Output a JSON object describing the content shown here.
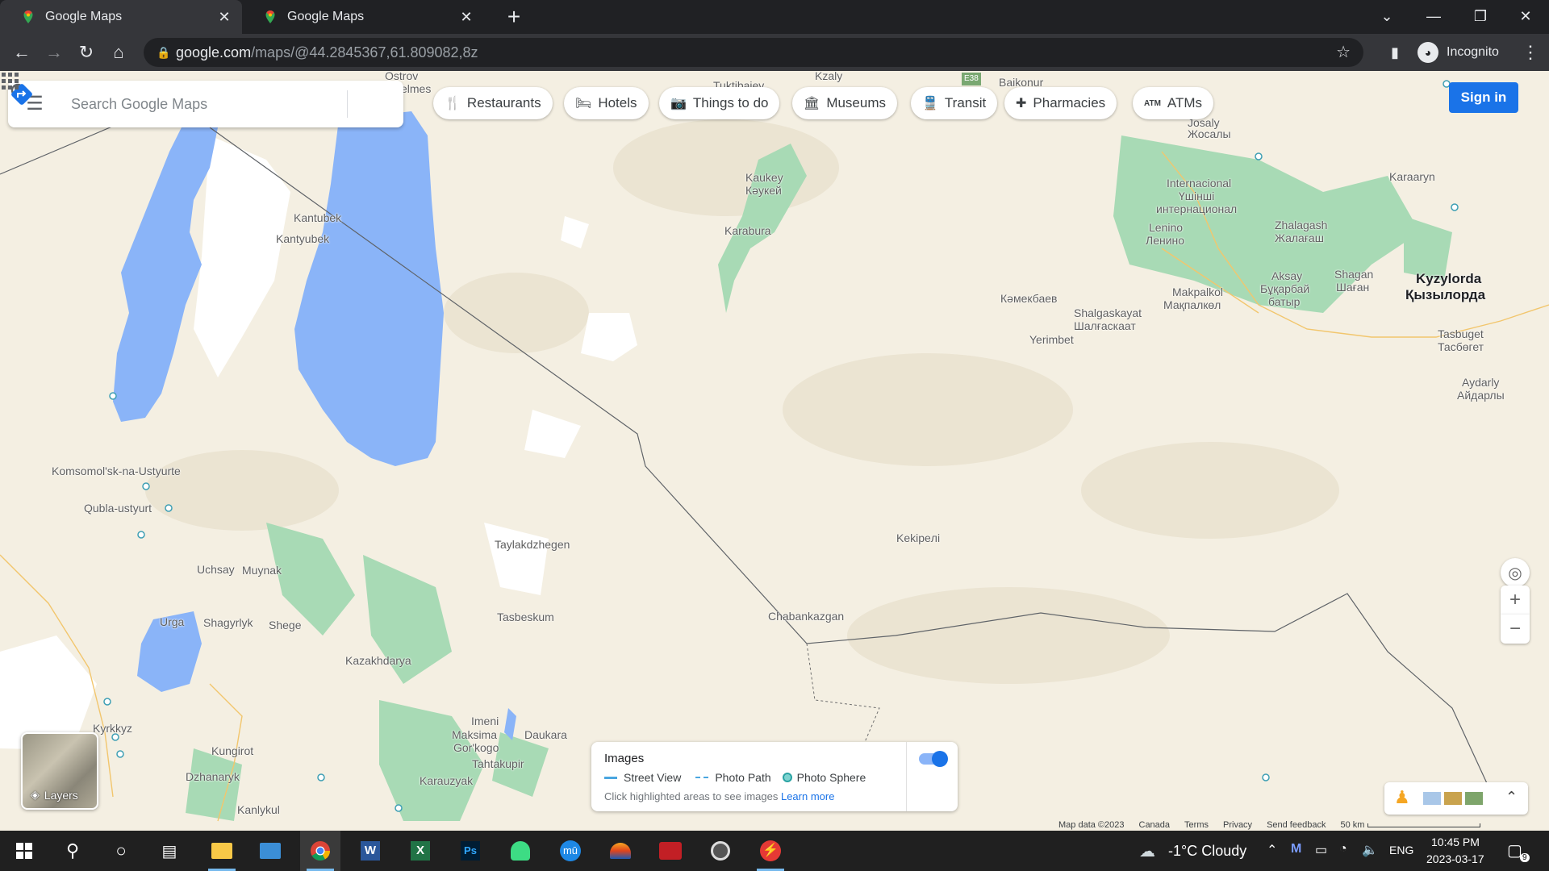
{
  "browser": {
    "tabs": [
      {
        "title": "Google Maps",
        "active": true
      },
      {
        "title": "Google Maps",
        "active": false
      }
    ],
    "url_host": "google.com",
    "url_path": "/maps/@44.2845367,61.809082,8z",
    "incognito_label": "Incognito"
  },
  "maps": {
    "search_placeholder": "Search Google Maps",
    "chips": [
      {
        "label": "Restaurants",
        "icon": "fork-knife-icon"
      },
      {
        "label": "Hotels",
        "icon": "bed-icon"
      },
      {
        "label": "Things to do",
        "icon": "camera-icon"
      },
      {
        "label": "Museums",
        "icon": "museum-icon"
      },
      {
        "label": "Transit",
        "icon": "train-icon"
      },
      {
        "label": "Pharmacies",
        "icon": "pharmacy-icon"
      },
      {
        "label": "ATMs",
        "icon": "atm-icon"
      }
    ],
    "sign_in": "Sign in",
    "layers_label": "Layers",
    "images_panel": {
      "title": "Images",
      "street_view": "Street View",
      "photo_path": "Photo Path",
      "photo_sphere": "Photo Sphere",
      "hint": "Click highlighted areas to see images",
      "learn_more": "Learn more",
      "toggle_on": true
    },
    "footer": {
      "map_data": "Map data ©2023",
      "country": "Canada",
      "terms": "Terms",
      "privacy": "Privacy",
      "feedback": "Send feedback",
      "scale": "50 km"
    },
    "places": [
      {
        "name": "Ostrov",
        "id": "p1"
      },
      {
        "name": "elmes",
        "id": "p2"
      },
      {
        "name": "Tuktibaiev",
        "id": "p3"
      },
      {
        "name": "Kzaly",
        "id": "p4"
      },
      {
        "name": "Baikonur",
        "id": "p5"
      },
      {
        "name": "E38",
        "id": "p6"
      },
      {
        "name": "Kaukey",
        "id": "p7"
      },
      {
        "name": "Кәукей",
        "id": "p8"
      },
      {
        "name": "Karabura",
        "id": "p9"
      },
      {
        "name": "Kantubek",
        "id": "p10"
      },
      {
        "name": "Kantyubek",
        "id": "p11"
      },
      {
        "name": "Komsomol'sk-na-Ustyurte",
        "id": "p12"
      },
      {
        "name": "Qubla-ustyurt",
        "id": "p13"
      },
      {
        "name": "Taylakdzhegen",
        "id": "p14"
      },
      {
        "name": "Uchsay",
        "id": "p15"
      },
      {
        "name": "Muynak",
        "id": "p16"
      },
      {
        "name": "Urga",
        "id": "p17"
      },
      {
        "name": "Shagyrlyk",
        "id": "p18"
      },
      {
        "name": "Shege",
        "id": "p19"
      },
      {
        "name": "Tasbeskum",
        "id": "p20"
      },
      {
        "name": "Kazakhdarya",
        "id": "p21"
      },
      {
        "name": "Chabankazgan",
        "id": "p22"
      },
      {
        "name": "Kekipeлi",
        "id": "p23"
      },
      {
        "name": "Kyrkkyz",
        "id": "p24"
      },
      {
        "name": "Kungirot",
        "id": "p25"
      },
      {
        "name": "Dzhanaryk",
        "id": "p26"
      },
      {
        "name": "Kanlykul",
        "id": "p27"
      },
      {
        "name": "Imeni",
        "id": "p28"
      },
      {
        "name": "Maksima",
        "id": "p29"
      },
      {
        "name": "Gor'kogo",
        "id": "p30"
      },
      {
        "name": "Daukara",
        "id": "p31"
      },
      {
        "name": "Tahtakupir",
        "id": "p32"
      },
      {
        "name": "Karauzyak",
        "id": "p33"
      },
      {
        "name": "Кәмекбаев",
        "id": "p34"
      },
      {
        "name": "Shalgaskayat",
        "id": "p35"
      },
      {
        "name": "Шалғаскаат",
        "id": "p36"
      },
      {
        "name": "Yerimbet",
        "id": "p37"
      },
      {
        "name": "Internacional",
        "id": "p38"
      },
      {
        "name": "Үшінші",
        "id": "p39"
      },
      {
        "name": "интернационал",
        "id": "p40"
      },
      {
        "name": "Lenino",
        "id": "p41"
      },
      {
        "name": "Ленино",
        "id": "p42"
      },
      {
        "name": "Makpalkol",
        "id": "p43"
      },
      {
        "name": "Мақпалкөл",
        "id": "p44"
      },
      {
        "name": "Zhalagash",
        "id": "p45"
      },
      {
        "name": "Жалағаш",
        "id": "p46"
      },
      {
        "name": "Aksay",
        "id": "p47"
      },
      {
        "name": "Бұқарбай",
        "id": "p48"
      },
      {
        "name": "батыр",
        "id": "p49"
      },
      {
        "name": "Shagan",
        "id": "p50"
      },
      {
        "name": "Шаған",
        "id": "p51"
      },
      {
        "name": "Kyzylorda",
        "id": "p52"
      },
      {
        "name": "Қызылорда",
        "id": "p53"
      },
      {
        "name": "Karaaryn",
        "id": "p54"
      },
      {
        "name": "Tasbuget",
        "id": "p55"
      },
      {
        "name": "Тасбөгет",
        "id": "p56"
      },
      {
        "name": "Aydarly",
        "id": "p57"
      },
      {
        "name": "Айдарлы",
        "id": "p58"
      },
      {
        "name": "Josaly",
        "id": "p59"
      },
      {
        "name": "Жосалы",
        "id": "p60"
      }
    ]
  },
  "taskbar": {
    "weather": "-1°C  Cloudy",
    "lang": "ENG",
    "time": "10:45 PM",
    "date": "2023-03-17",
    "notifications": "9"
  }
}
